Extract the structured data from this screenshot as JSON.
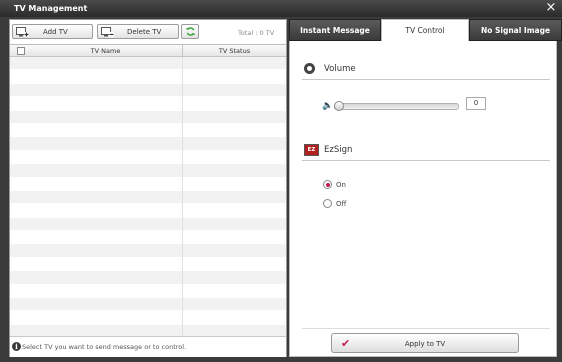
{
  "window": {
    "title": "TV Management",
    "close_label": "×"
  },
  "toolbar": {
    "add_label": "Add TV",
    "delete_label": "Delete TV",
    "total_label": "Total :",
    "total_count": "0 TV"
  },
  "table": {
    "col_name": "TV Name",
    "col_status": "TV Status",
    "row_count": 21
  },
  "footer": {
    "info_icon": "i",
    "message": "Select TV you want to send message or to control."
  },
  "tabs": [
    {
      "label": "Instant Message"
    },
    {
      "label": "TV Control"
    },
    {
      "label": "No Signal Image"
    }
  ],
  "volume": {
    "title": "Volume",
    "value": "0",
    "level": 0
  },
  "ezsign": {
    "title": "EzSign",
    "icon_text": "EZ",
    "on_label": "On",
    "off_label": "Off",
    "selected": "On"
  },
  "apply": {
    "label": "Apply to TV"
  },
  "colors": {
    "accent": "#c2185b",
    "titlebar": "#2b2b2b",
    "icon_red": "#b32020"
  }
}
